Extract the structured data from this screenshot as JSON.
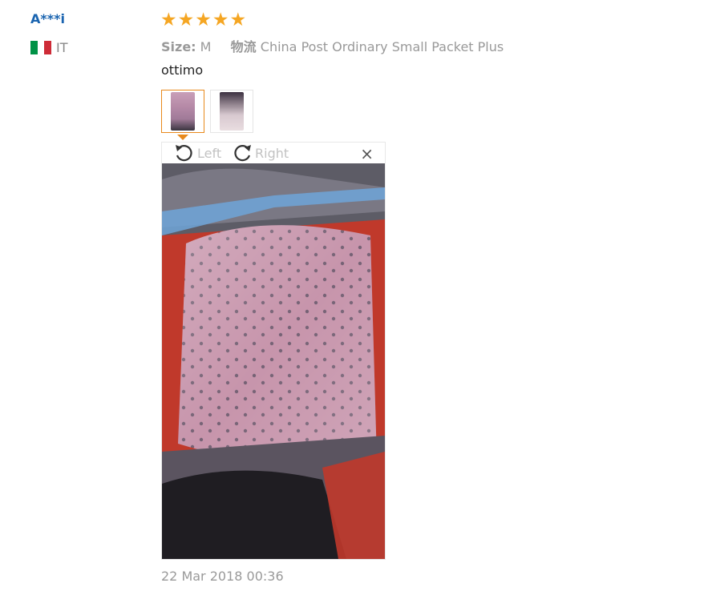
{
  "review": {
    "username": "A***i",
    "country_code": "IT",
    "flag_colors": [
      "#009246",
      "#ffffff",
      "#ce2b37"
    ],
    "rating": 5,
    "star_glyph": "★",
    "star_color": "#f5a623",
    "size_label": "Size:",
    "size_value": "M",
    "shipping_label": "物流",
    "shipping_value": "China Post Ordinary Small Packet Plus",
    "comment": "ottimo",
    "date": "22 Mar 2018 00:36"
  },
  "viewer": {
    "rotate_left_label": "Left",
    "rotate_right_label": "Right",
    "close_glyph": "×",
    "accent_color": "#e8891c"
  },
  "thumbnails": [
    {
      "name": "photo-thumbnail-1",
      "selected": true
    },
    {
      "name": "photo-thumbnail-2",
      "selected": false
    }
  ]
}
